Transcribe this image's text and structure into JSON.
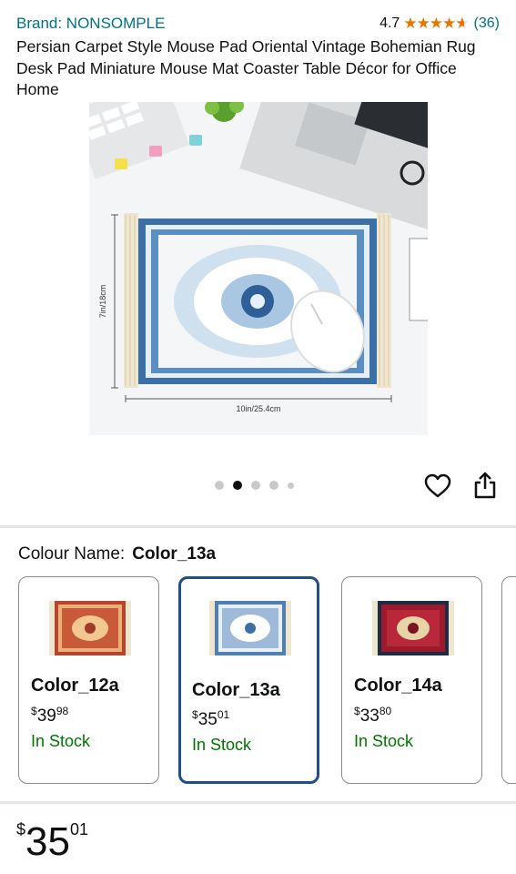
{
  "product": {
    "brand": "Brand: NONSOMPLE",
    "rating_value": "4.7",
    "rating_count": "(36)",
    "title": "Persian Carpet Style Mouse Pad Oriental Vintage Bohemian Rug Desk Pad Miniature Mouse Mat Coaster Table Décor for Office Home"
  },
  "image": {
    "height_label": "7in/18cm",
    "width_label": "10in/25.4cm",
    "carousel_count": 5,
    "carousel_active": 2
  },
  "colour": {
    "label": "Colour Name:",
    "selected": "Color_13a",
    "options": [
      {
        "name": "Color_12a",
        "currency": "$",
        "whole": "39",
        "fraction": "98",
        "stock": "In Stock"
      },
      {
        "name": "Color_13a",
        "currency": "$",
        "whole": "35",
        "fraction": "01",
        "stock": "In Stock"
      },
      {
        "name": "Color_14a",
        "currency": "$",
        "whole": "33",
        "fraction": "80",
        "stock": "In Stock"
      }
    ]
  },
  "price": {
    "currency": "$",
    "whole": "35",
    "fraction": "01"
  },
  "icons": {
    "wishlist": "heart-icon",
    "share": "share-icon",
    "rating": "star-icon"
  },
  "colors": {
    "link": "#007185",
    "stock": "#007600",
    "selected_border": "#1f4e8c",
    "star": "#e77600"
  }
}
